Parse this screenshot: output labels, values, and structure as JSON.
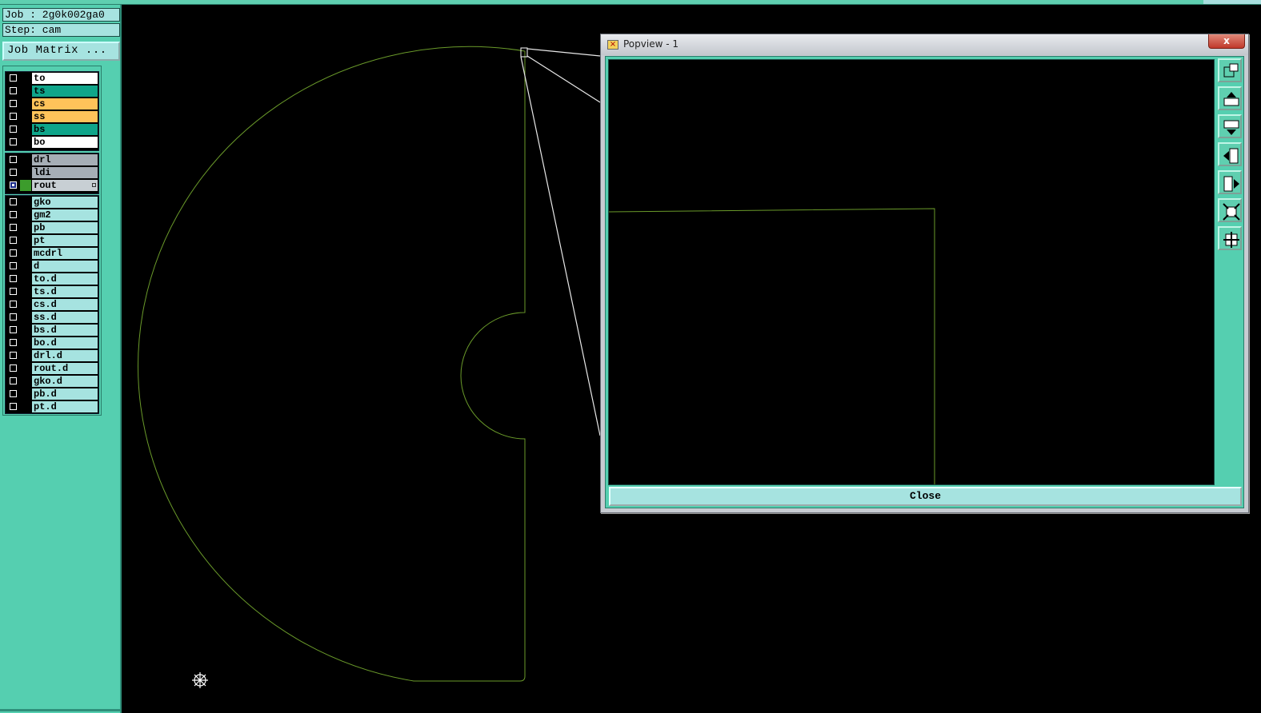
{
  "header": {
    "job": "Job : 2g0k002ga0",
    "step": "Step: cam",
    "job_matrix": "Job Matrix ..."
  },
  "layers": {
    "board": [
      {
        "name": "to",
        "color": "#ffffff"
      },
      {
        "name": "ts",
        "color": "#0fa58a"
      },
      {
        "name": "cs",
        "color": "#ffc35a"
      },
      {
        "name": "ss",
        "color": "#ffc35a"
      },
      {
        "name": "bs",
        "color": "#0fa58a"
      },
      {
        "name": "bo",
        "color": "#ffffff"
      }
    ],
    "drill": [
      {
        "name": "drl",
        "color": "#a6aeb6"
      },
      {
        "name": "ldi",
        "color": "#a6aeb6"
      },
      {
        "name": "rout",
        "color": "#c8cfd4",
        "selected": true,
        "swatch": "#3c9c2c"
      }
    ],
    "misc": [
      {
        "name": "gko",
        "color": "#a6e3e0"
      },
      {
        "name": "gm2",
        "color": "#a6e3e0"
      },
      {
        "name": "pb",
        "color": "#a6e3e0"
      },
      {
        "name": "pt",
        "color": "#a6e3e0"
      },
      {
        "name": "mcdrl",
        "color": "#a6e3e0"
      },
      {
        "name": "d",
        "color": "#a6e3e0"
      },
      {
        "name": "to.d",
        "color": "#a6e3e0"
      },
      {
        "name": "ts.d",
        "color": "#a6e3e0"
      },
      {
        "name": "cs.d",
        "color": "#a6e3e0"
      },
      {
        "name": "ss.d",
        "color": "#a6e3e0"
      },
      {
        "name": "bs.d",
        "color": "#a6e3e0"
      },
      {
        "name": "bo.d",
        "color": "#a6e3e0"
      },
      {
        "name": "drl.d",
        "color": "#a6e3e0"
      },
      {
        "name": "rout.d",
        "color": "#a6e3e0"
      },
      {
        "name": "gko.d",
        "color": "#a6e3e0"
      },
      {
        "name": "pb.d",
        "color": "#a6e3e0"
      },
      {
        "name": "pt.d",
        "color": "#a6e3e0"
      }
    ]
  },
  "popview": {
    "title": "Popview - 1",
    "close_label": "Close",
    "close_x": "x",
    "toolbar": [
      "zoom-window-icon",
      "pan-up-icon",
      "pan-down-icon",
      "pan-left-icon",
      "pan-right-icon",
      "zoom-home-icon",
      "zoom-fit-icon"
    ]
  },
  "colors": {
    "outline": "#6a9a2a",
    "panel": "#55cfb0",
    "field": "#a6e3e0"
  }
}
